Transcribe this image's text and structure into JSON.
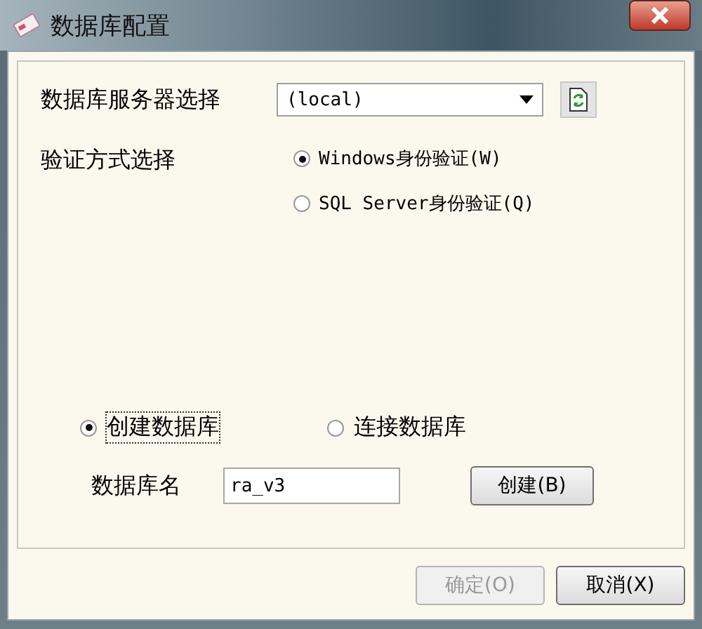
{
  "window": {
    "title": "数据库配置"
  },
  "server": {
    "label": "数据库服务器选择",
    "value": "(local)"
  },
  "auth": {
    "label": "验证方式选择",
    "options": [
      {
        "label": "Windows身份验证(W)",
        "selected": true
      },
      {
        "label": "SQL Server身份验证(Q)",
        "selected": false
      }
    ]
  },
  "mode": {
    "options": [
      {
        "label": "创建数据库",
        "selected": true,
        "focused": true
      },
      {
        "label": "连接数据库",
        "selected": false,
        "focused": false
      }
    ]
  },
  "database": {
    "label": "数据库名",
    "value": "ra_v3",
    "button": "创建(B)"
  },
  "buttons": [
    {
      "label": "确定(O)",
      "disabled": true
    },
    {
      "label": "取消(X)",
      "disabled": false
    }
  ]
}
